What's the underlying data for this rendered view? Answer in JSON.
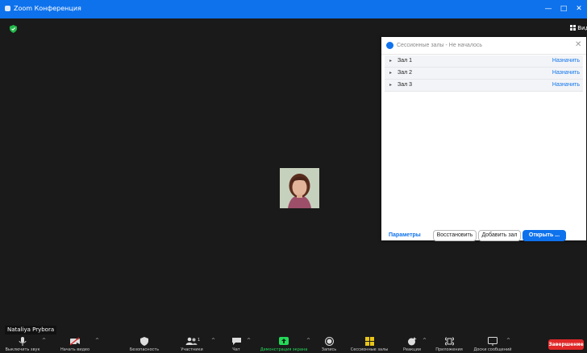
{
  "window": {
    "title": "Zoom Конференция",
    "minimize": "—",
    "maximize": "□",
    "close": "✕"
  },
  "stage": {
    "view_label": "Вид",
    "participant_name": "Nataliya Prybora"
  },
  "breakout_panel": {
    "title": "Сессионные залы - Не началось",
    "close": "✕",
    "rooms": [
      {
        "name": "Зал 1",
        "action": "Назначить"
      },
      {
        "name": "Зал 2",
        "action": "Назначить"
      },
      {
        "name": "Зал 3",
        "action": "Назначить"
      }
    ],
    "params_label": "Параметры",
    "restore_label": "Восстановить",
    "add_room_label": "Добавить зал",
    "open_label": "Открыть ..."
  },
  "toolbar": {
    "mute": "Выключить звук",
    "video": "Начать видео",
    "security": "Безопасность",
    "participants": "Участники",
    "participants_count": "1",
    "chat": "Чат",
    "share": "Демонстрация экрана",
    "record": "Запись",
    "breakout": "Сессионные залы",
    "reactions": "Реакции",
    "apps": "Приложения",
    "whiteboard": "Доски сообщений",
    "end": "Завершение"
  },
  "colors": {
    "accent": "#0e72ed",
    "share_green": "#23d959",
    "end_red": "#e02828",
    "background": "#1a1a1a"
  }
}
